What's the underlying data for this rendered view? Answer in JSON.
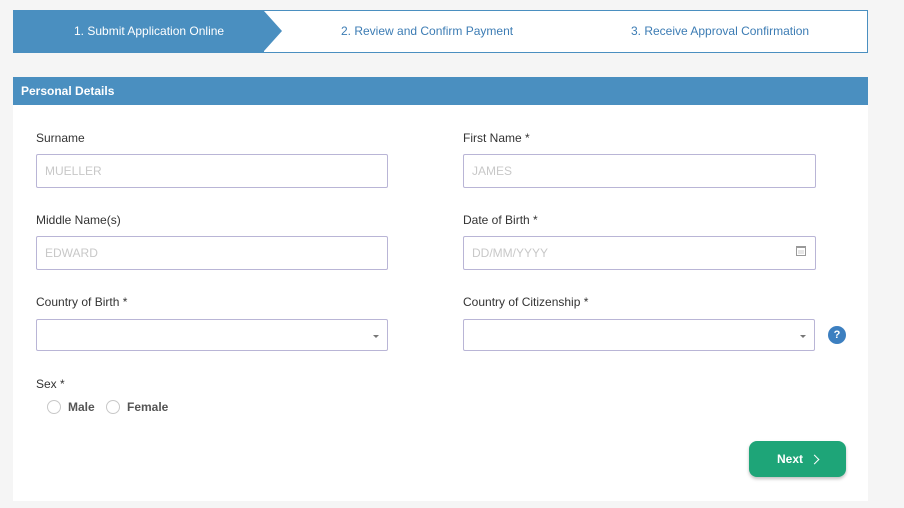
{
  "steps": [
    {
      "label": "1. Submit Application Online",
      "active": true
    },
    {
      "label": "2. Review and Confirm Payment",
      "active": false
    },
    {
      "label": "3. Receive Approval Confirmation",
      "active": false
    }
  ],
  "section": {
    "title": "Personal Details"
  },
  "form": {
    "surname": {
      "label": "Surname",
      "placeholder": "MUELLER",
      "value": ""
    },
    "first_name": {
      "label": "First Name *",
      "placeholder": "JAMES",
      "value": ""
    },
    "middle_name": {
      "label": "Middle Name(s)",
      "placeholder": "EDWARD",
      "value": ""
    },
    "date_of_birth": {
      "label": "Date of Birth *",
      "placeholder": "DD/MM/YYYY",
      "value": ""
    },
    "country_of_birth": {
      "label": "Country of Birth *",
      "selected": ""
    },
    "country_of_citizenship": {
      "label": "Country of Citizenship *",
      "selected": ""
    },
    "help_glyph": "?",
    "sex": {
      "label": "Sex *",
      "options": [
        "Male",
        "Female"
      ]
    }
  },
  "actions": {
    "next_label": "Next"
  },
  "colors": {
    "primary": "#4a8fc0",
    "step_text": "#3c7cb4",
    "next_button": "#1ea578",
    "input_border": "#b9b5d6"
  },
  "icons": [
    "calendar-icon",
    "chevron-down-icon",
    "help-icon",
    "chevron-right-icon"
  ]
}
